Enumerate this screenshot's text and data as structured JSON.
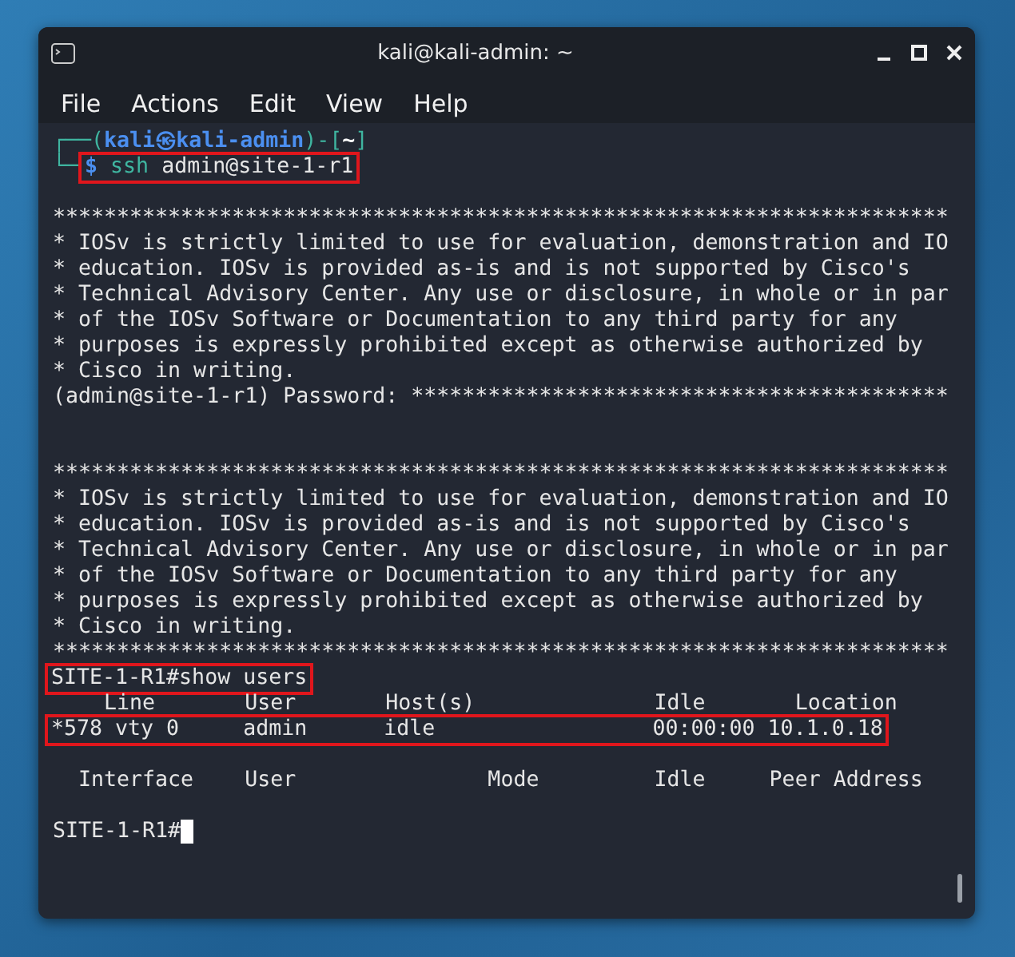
{
  "window": {
    "title": "kali@kali-admin: ~"
  },
  "menu": [
    {
      "label": "File"
    },
    {
      "label": "Actions"
    },
    {
      "label": "Edit"
    },
    {
      "label": "View"
    },
    {
      "label": "Help"
    }
  ],
  "terminal": {
    "lines": [
      {
        "kind": "kali-prompt",
        "open": "┌──(",
        "user": "kali",
        "at": "㉿",
        "host": "kali-admin",
        "mid": ")-[",
        "dir": "~",
        "close": "]"
      },
      {
        "kind": "kali-command",
        "prefix": "└─",
        "symbol": "$",
        "program": "ssh",
        "args": "admin@site-1-r1",
        "highlighted": true
      },
      {
        "kind": "blank"
      },
      {
        "kind": "text",
        "text": "**********************************************************************",
        "highlighted": false
      },
      {
        "kind": "text",
        "text": "* IOSv is strictly limited to use for evaluation, demonstration and IO",
        "highlighted": false
      },
      {
        "kind": "text",
        "text": "* education. IOSv is provided as-is and is not supported by Cisco's",
        "highlighted": false
      },
      {
        "kind": "text",
        "text": "* Technical Advisory Center. Any use or disclosure, in whole or in par",
        "highlighted": false
      },
      {
        "kind": "text",
        "text": "* of the IOSv Software or Documentation to any third party for any",
        "highlighted": false
      },
      {
        "kind": "text",
        "text": "* purposes is expressly prohibited except as otherwise authorized by",
        "highlighted": false
      },
      {
        "kind": "text",
        "text": "* Cisco in writing.",
        "highlighted": false
      },
      {
        "kind": "text",
        "text": "(admin@site-1-r1) Password: ******************************************",
        "highlighted": false
      },
      {
        "kind": "blank"
      },
      {
        "kind": "blank"
      },
      {
        "kind": "text",
        "text": "**********************************************************************",
        "highlighted": false
      },
      {
        "kind": "text",
        "text": "* IOSv is strictly limited to use for evaluation, demonstration and IO",
        "highlighted": false
      },
      {
        "kind": "text",
        "text": "* education. IOSv is provided as-is and is not supported by Cisco's",
        "highlighted": false
      },
      {
        "kind": "text",
        "text": "* Technical Advisory Center. Any use or disclosure, in whole or in par",
        "highlighted": false
      },
      {
        "kind": "text",
        "text": "* of the IOSv Software or Documentation to any third party for any",
        "highlighted": false
      },
      {
        "kind": "text",
        "text": "* purposes is expressly prohibited except as otherwise authorized by",
        "highlighted": false
      },
      {
        "kind": "text",
        "text": "* Cisco in writing.",
        "highlighted": false
      },
      {
        "kind": "text",
        "text": "**********************************************************************",
        "highlighted": false
      },
      {
        "kind": "text",
        "text": "SITE-1-R1#show users",
        "highlighted": true
      },
      {
        "kind": "text",
        "text": "    Line       User       Host(s)              Idle       Location",
        "highlighted": false
      },
      {
        "kind": "text",
        "text": "*578 vty 0     admin      idle                 00:00:00 10.1.0.18",
        "highlighted": true
      },
      {
        "kind": "blank"
      },
      {
        "kind": "text",
        "text": "  Interface    User               Mode         Idle     Peer Address",
        "highlighted": false
      },
      {
        "kind": "blank"
      },
      {
        "kind": "text",
        "text": "SITE-1-R1#",
        "highlighted": false,
        "cursor": true
      }
    ]
  }
}
